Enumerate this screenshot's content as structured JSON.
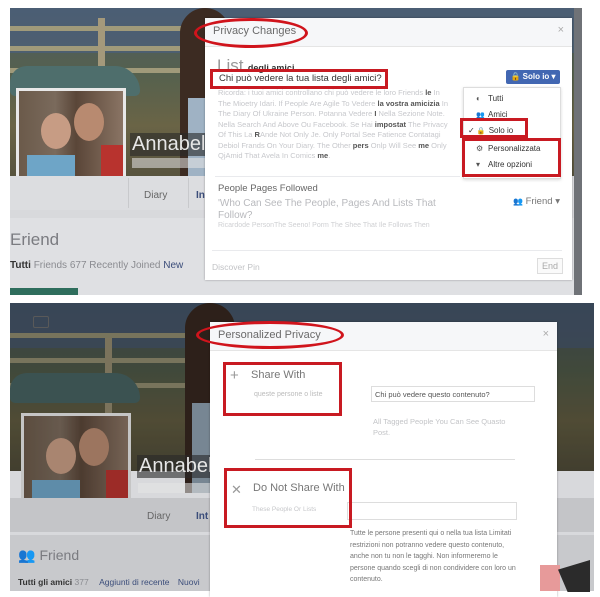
{
  "top_panel": {
    "profile": {
      "name": "Annabell",
      "tabs": {
        "diary": "Diary",
        "info": "Int"
      },
      "friends": {
        "title": "Eriend",
        "links": {
          "all": "Tutti",
          "rest": "Friends 677 Recently Joined",
          "new": "New"
        }
      }
    },
    "dialog": {
      "title": "Privacy Changes",
      "close_icon": "×",
      "list_heading_big": "List",
      "list_heading_small": "degli amici",
      "question": "Chi può vedere la tua lista degli amici?",
      "description": [
        {
          "t": "Ricorda: i tuoi amici controllano chi può vedere le loro ",
          "b": false
        },
        {
          "t": "Friends",
          "b": false
        },
        {
          "t": " le ",
          "b": true
        },
        {
          "t": "In The Mioetry Idari. If People Are Agile To Vedere ",
          "b": false
        },
        {
          "t": "la vostra amicizia",
          "b": true
        },
        {
          "t": " In The Diary Of Ukraine Person. Potanna Vedere ",
          "b": false
        },
        {
          "t": "I",
          "b": true
        },
        {
          "t": " Nella Sezione Note. Nella Search And Above Ou Facebook. Se Hai ",
          "b": false
        },
        {
          "t": "impostat",
          "b": true
        },
        {
          "t": " The Privacy Of This La ",
          "b": false
        },
        {
          "t": "R",
          "b": true
        },
        {
          "t": "Ande Not Only Je. Only Portal See Fatience Contatagi Debiol Frands On Your Diary. The Other ",
          "b": false
        },
        {
          "t": "pers",
          "b": true
        },
        {
          "t": " Onlp Will See ",
          "b": false
        },
        {
          "t": "me",
          "b": true
        },
        {
          "t": " Only QjAmid That Avela In Comics ",
          "b": false
        },
        {
          "t": "me",
          "b": true
        },
        {
          "t": ".",
          "b": false
        }
      ],
      "privacy_button": {
        "label": "Solo io",
        "icon": "lock-icon"
      },
      "menu": [
        {
          "label": "Tutti",
          "icon": "globe-icon",
          "glyph": "◐"
        },
        {
          "label": "Amici",
          "icon": "friends-icon",
          "glyph": "👥"
        },
        {
          "label": "Solo io",
          "icon": "lock-icon",
          "glyph": "🔒",
          "selected": true
        },
        {
          "label": "Personalizzata",
          "icon": "gear-icon",
          "glyph": "⚙"
        },
        {
          "label": "Altre opzioni",
          "icon": "caret-down-icon",
          "glyph": "▾"
        }
      ],
      "checkmark": "✓",
      "people_pages": {
        "title": "People Pages Followed",
        "question": "'Who Can See The People, Pages And Lists That Follow?",
        "note": "Ricardode PersonThe Seeno! Porm  The Shee That Ile Follows Then",
        "friend_button": "Friend"
      },
      "footer": {
        "discover": "Discover Pin",
        "end": "End"
      }
    }
  },
  "bottom_panel": {
    "profile": {
      "name": "Annabella",
      "tabs": {
        "diary": "Diary",
        "info": "Int"
      },
      "friends": {
        "title": "Friend",
        "links": {
          "all": "Tutti gli amici",
          "count": "377",
          "recent": "Aggiunti di recente",
          "new": "Nuovi"
        }
      }
    },
    "dialog": {
      "title": "Personalized Privacy",
      "close_icon": "×",
      "share_with": {
        "icon": "plus-icon",
        "glyph": "+",
        "title": "Share With",
        "subtitle": "queste persone o liste",
        "input_value": "Chi può vedere questo contenuto?",
        "tag_note": "All Tagged People You Can See Quasto Post."
      },
      "do_not_share_with": {
        "icon": "close-icon",
        "glyph": "✕",
        "title": "Do Not Share With",
        "subtitle": "These People Or Lists",
        "input_value": "",
        "note": "Tutte le persone presenti qui o nella tua lista Limitati restrizioni non potranno vedere questo contenuto, anche non tu non le tagghi. Non informeremo le persone quando scegli di non condividere con loro un contenuto."
      }
    }
  },
  "colors": {
    "annotation_red": "#c81a22",
    "facebook_blue": "#4267b2"
  }
}
